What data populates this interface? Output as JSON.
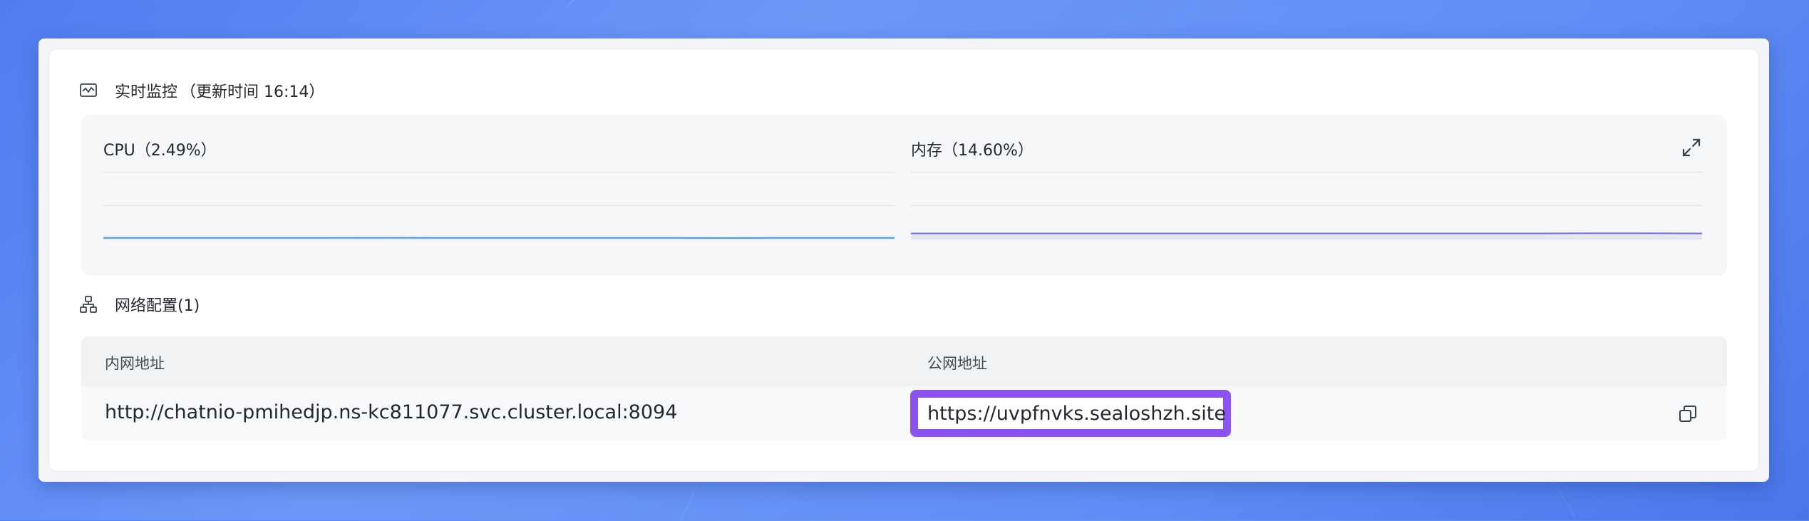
{
  "monitor": {
    "icon": "monitor-chart-icon",
    "title": "实时监控",
    "update_text": "（更新时间  16:14）"
  },
  "cpu": {
    "label": "CPU",
    "value_text": "（2.49%）",
    "color": "#3b9bea",
    "chart_data": {
      "type": "line",
      "title": "CPU",
      "xlabel": "",
      "ylabel": "",
      "ylim": [
        0,
        100
      ],
      "grid": true,
      "values": [
        2.4,
        2.5,
        2.5,
        2.6,
        2.5,
        2.7,
        2.6,
        2.6,
        2.5,
        2.6,
        2.4,
        2.1,
        2.3,
        2.5,
        2.49
      ]
    }
  },
  "memory": {
    "label": "内存",
    "value_text": "（14.60%）",
    "color": "#7b6cf0",
    "chart_data": {
      "type": "area",
      "title": "内存",
      "xlabel": "",
      "ylabel": "",
      "ylim": [
        0,
        100
      ],
      "grid": true,
      "values": [
        14.5,
        14.5,
        14.5,
        14.6,
        14.5,
        14.5,
        14.6,
        14.6,
        14.5,
        14.6,
        14.6,
        14.6,
        15.1,
        14.8,
        14.6
      ]
    }
  },
  "network": {
    "icon": "network-icon",
    "title": "网络配置(1)",
    "columns": [
      "内网地址",
      "公网地址"
    ],
    "rows": [
      {
        "internal": "http://chatnio-pmihedjp.ns-kc811077.svc.cluster.local:8094",
        "public": "https://uvpfnvks.sealoshzh.site"
      }
    ]
  },
  "colors": {
    "accent": "#8b53f2",
    "text": "#24282e"
  }
}
